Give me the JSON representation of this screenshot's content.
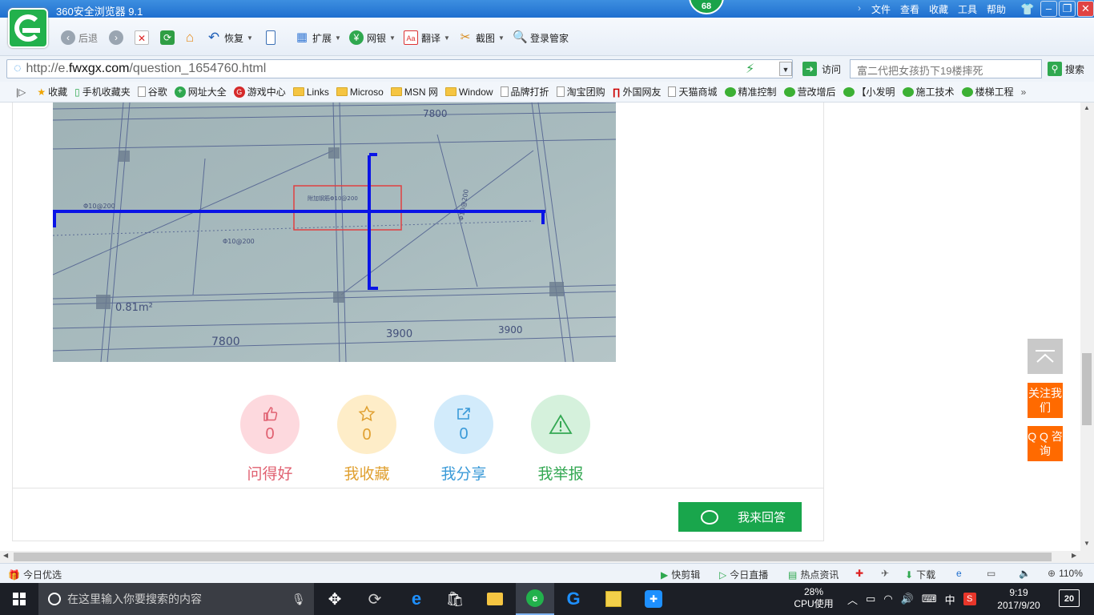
{
  "browser": {
    "title": "360安全浏览器 9.1",
    "badge_count": "68",
    "menus": [
      "文件",
      "查看",
      "收藏",
      "工具",
      "帮助"
    ],
    "toolbar": {
      "back": "后退",
      "restore": "恢复",
      "extend": "扩展",
      "bank": "网银",
      "translate": "翻译",
      "screenshot": "截图",
      "login": "登录管家"
    },
    "address": {
      "url_prefix": "http://e.",
      "url_domain": "fwxgx.com",
      "url_path": "/question_1654760.html",
      "visit": "访问",
      "search_placeholder": "富二代把女孩扔下19楼摔死",
      "search_button": "搜索"
    },
    "bookmarks": [
      "收藏",
      "手机收藏夹",
      "谷歌",
      "网址大全",
      "游戏中心",
      "Links",
      "Microso",
      "MSN 网",
      "Window",
      "品牌打折",
      "淘宝团购",
      "外国网友",
      "天猫商城",
      "精准控制",
      "营改增后",
      "【小发明",
      "施工技术",
      "楼梯工程"
    ]
  },
  "page": {
    "drawing_labels": {
      "top_dim": "7800",
      "bottom_left_dim": "7800",
      "bottom_mid_dim": "3900",
      "bottom_right_dim": "3900",
      "area": "0.81m²",
      "rebar_a": "Φ10@200",
      "rebar_b": "Φ10@200",
      "rebar_c": "Φ10@200",
      "highlight": "附加钢筋Φ10@200"
    },
    "actions": [
      {
        "label": "问得好",
        "count": "0",
        "color": "#e06070",
        "bg": "#fdd9de"
      },
      {
        "label": "我收藏",
        "count": "0",
        "color": "#e0a030",
        "bg": "#feedc8"
      },
      {
        "label": "我分享",
        "count": "0",
        "color": "#3a9ad8",
        "bg": "#d2ebfb"
      },
      {
        "label": "我举报",
        "count": "0",
        "color": "#34a853",
        "bg": "#d5f1dc"
      }
    ],
    "answer_button": "我来回答",
    "follow_us": "关注我们",
    "qq_consult": "Q Q 咨询"
  },
  "statusbar": {
    "today_pick": "今日优选",
    "quick_clip": "快剪辑",
    "live": "今日直播",
    "news": "热点资讯",
    "download": "下载",
    "zoom": "110%"
  },
  "taskbar": {
    "search_placeholder": "在这里输入你要搜索的内容",
    "cpu_percent": "28%",
    "cpu_label": "CPU使用",
    "ime": "中",
    "time": "9:19",
    "date": "2017/9/20",
    "notifications": "20"
  }
}
